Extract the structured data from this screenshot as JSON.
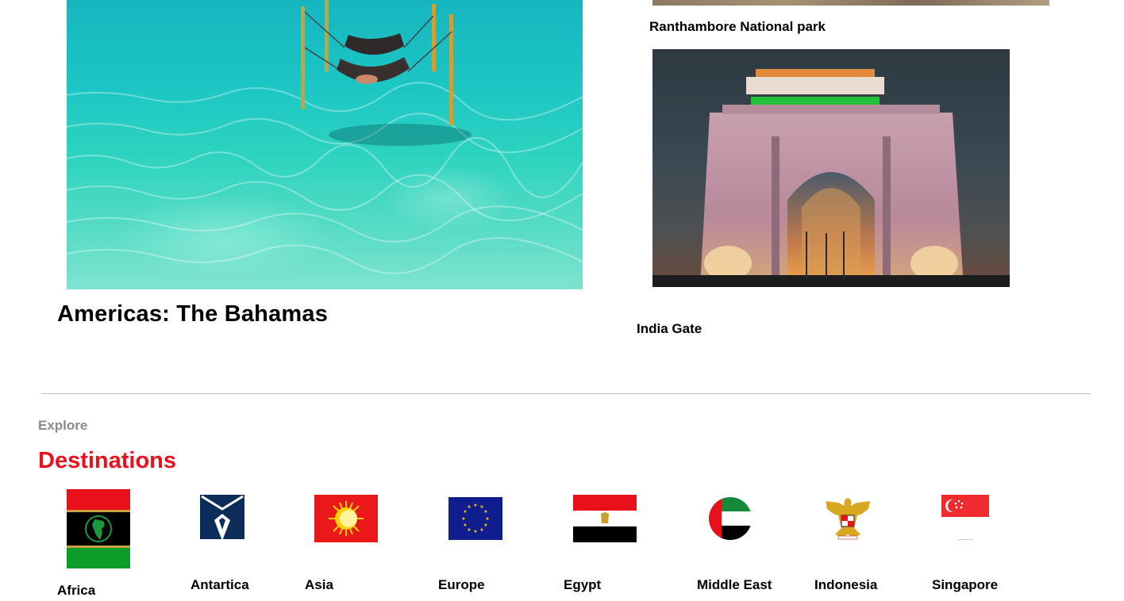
{
  "featured": {
    "main_caption": "Americas: The Bahamas",
    "side_items": [
      {
        "caption": "Ranthambore National park"
      },
      {
        "caption": "India Gate"
      }
    ]
  },
  "explore": {
    "kicker": "Explore",
    "heading": "Destinations",
    "heading_color": "#e8111b",
    "items": [
      {
        "label": "Africa",
        "icon": "african-union-flag"
      },
      {
        "label": "Antartica",
        "icon": "antarctica-flag"
      },
      {
        "label": "Asia",
        "icon": "asia-sun-flag"
      },
      {
        "label": "Europe",
        "icon": "eu-flag"
      },
      {
        "label": "Egypt",
        "icon": "egypt-flag"
      },
      {
        "label": "Middle East",
        "icon": "uae-circle-flag"
      },
      {
        "label": "Indonesia",
        "icon": "garuda-emblem"
      },
      {
        "label": "Singapore",
        "icon": "singapore-flag"
      }
    ]
  }
}
